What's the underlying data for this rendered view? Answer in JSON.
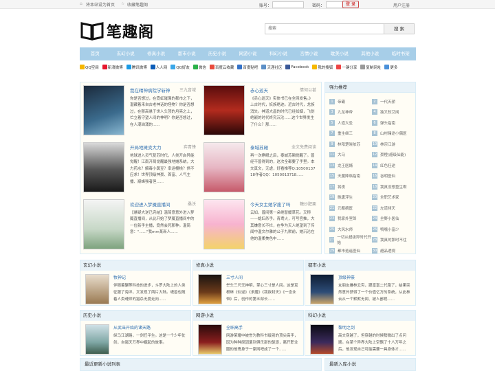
{
  "topbar": {
    "set_home": "将本站设为首页",
    "bookmark": "收藏笔趣阁",
    "account_label": "账号：",
    "password_label": "密码：",
    "login": "登 录",
    "register": "用户注册"
  },
  "logo": {
    "text": "笔趣阁"
  },
  "search": {
    "placeholder": "搜索",
    "button": "搜 索"
  },
  "nav": [
    "首页",
    "玄幻小说",
    "修真小说",
    "都市小说",
    "历史小说",
    "网游小说",
    "科幻小说",
    "言情小说",
    "耽美小说",
    "其他小说",
    "临时书架"
  ],
  "share": [
    "QQ空间",
    "新浪微博",
    "腾讯微博",
    "人人网",
    "QQ好友",
    "微信",
    "百度云收藏",
    "百度贴吧",
    "天涯社区",
    "Facebook",
    "我的搜狐",
    "一键分享",
    "复制网址",
    "更多"
  ],
  "featured": [
    {
      "title": "我在精神病院学斩神",
      "author": "三九音域",
      "desc": "你是否想过，在霓虹璀璨的都市之下，潜藏着来自古老神话的怪物？你是否想过，在那高悬于世人头顶的月亮之上，伫立着守望人间的神明？你是否想过，在人潮汹涌的......"
    },
    {
      "title": "赤心巡天",
      "author": "情何以甚",
      "desc": "《赤心巡天》实体书已在全网发售。》上古时代，妖族绝迹。近古时代，龙族消失。神道大昌的时代已经如烟，飞剑绝巅的时代终究沉沦......这个世界发生了什么？那......"
    },
    {
      "title": "开局地摊卖大力",
      "author": "弈青锋",
      "desc": "地球进入灵气复苏时代，人类开启异能觉醒！江南开局觉醒最强地摊系统，大力药水？解毒小黄豆？幸运樱桃？供不应求！世界顶级神豪、首富、人气主播、巅峰强者但......"
    },
    {
      "title": "泰城苏厢",
      "author": "全文免费阅读",
      "desc": "再一次睁眼之后，泰城苏厢觉醒了。曾经不曾得到的，这次全都要了手里。本文真文，无虐，好看推荐Q:1050013718作者QQ：1050013718......"
    },
    {
      "title": "欢迎进入梦魇直播间",
      "author": "桑沃",
      "desc": "【悬疑大逆已完结】温简意意外进入梦魇直播间，从此开始了梦魇直播间中的一位新手主播，竟然会死那种。温简意：\"......\"我mm某新人......"
    },
    {
      "title": "今天女主她学废了吗",
      "author": "糖炒肥栗",
      "desc": "云如，曾间第一朵绝智媛草花。又称——媳妇杀手。青鸢火，可号官推，大其嫌意长不拦，在争为天人绝望到了传闻中温文尔雅的公子九默前，她沉沦在他的温柔美色中......"
    }
  ],
  "side": {
    "title": "强力推荐",
    "items": [
      "帝霸",
      "一代天骄",
      "九龙神帝",
      "独又软艾阅",
      "人道大圣",
      "弹头指南",
      "重生继三",
      "山村赌途小偶医",
      "林阳楚晓依苏",
      "林宗江游",
      "大马",
      "豪橙(超级仙能)",
      "龙王医婿",
      "红色狂途",
      "天魔降临指南",
      "谷明医仙",
      "将夜",
      "我真没想重生啊",
      "晚唐浮生",
      "全职艺术家",
      "元都摘医",
      "左道倾天",
      "我家外室郎",
      "全野小医仙",
      "大风水师",
      "鸭嘴小富少",
      "一切从超级异时代开始",
      "我真的那时不往",
      "都市逃遥医仙",
      "超品透视"
    ]
  },
  "categories": [
    {
      "label": "玄幻小说",
      "title": "牧神记",
      "desc": "伴随着碾等科技的进步，斗罗大陆上的人类征服了海洋，又发现了两片大陆。魂兽也随着人类魂师的猎杀无度走向......"
    },
    {
      "label": "修真小说",
      "title": "三寸人间",
      "desc": "举头三尺无神明，掌心三寸是人间。这是耳根继《仙逆》《求魔》《我欲封天》《一念永恒》后，创作的第五部长......"
    },
    {
      "label": "都市小说",
      "title": "顶级神豪",
      "desc": "女朋友嫌林云穷，跟富富二代跑了，结果突然意外获得了一个价值亿万的系统，从此林云从一个默默无闻、被人鄙视......"
    },
    {
      "label": "历史小说",
      "title": "从武当开始的诸天路",
      "desc": "纵马江湖路，一剑任平生。这是一个少年仗剑，自诸天万界中崛起的故事。"
    },
    {
      "label": "网游小说",
      "title": "全职高手",
      "desc": "网游荣耀中被誉为教科书级别的顶尖高手，因为种种原因遭到俱乐部的驱逐，离开职业圈的他寄身于一家网吧成了一个......"
    },
    {
      "label": "科幻小说",
      "title": "黎明之剑",
      "desc": "高文穿越了，但穿越的时候稍微出了点问题。在某个异界大陆上空飘了十八万年之后，他发现自己可能需要一具身体才......"
    }
  ],
  "bottom": {
    "left": "最近更新小说列表",
    "right": "最新入库小说"
  },
  "colors": {
    "nav": "#a7cee8",
    "link": "#2f6fb0",
    "panel_bg": "#fffdf5",
    "header_bg": "#e8f2f8"
  }
}
